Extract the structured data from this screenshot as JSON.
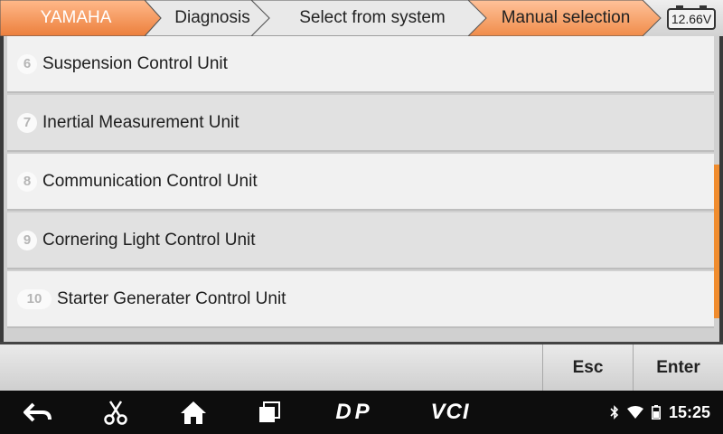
{
  "header": {
    "breadcrumbs": [
      {
        "label": "YAMAHA"
      },
      {
        "label": "Diagnosis"
      },
      {
        "label": "Select from system"
      },
      {
        "label": "Manual selection"
      }
    ],
    "battery_voltage": "12.66V"
  },
  "list": {
    "items": [
      {
        "number": "6",
        "label": "Suspension Control Unit"
      },
      {
        "number": "7",
        "label": "Inertial Measurement Unit"
      },
      {
        "number": "8",
        "label": "Communication Control Unit"
      },
      {
        "number": "9",
        "label": "Cornering Light Control Unit"
      },
      {
        "number": "10",
        "label": "Starter Generater Control Unit"
      }
    ]
  },
  "actions": {
    "esc_label": "Esc",
    "enter_label": "Enter"
  },
  "navbar": {
    "icons": [
      "back-icon",
      "scissors-icon",
      "home-icon",
      "recent-apps-icon",
      "dp-logo-icon",
      "vci-logo-icon"
    ],
    "dp_text": "DP",
    "vci_text": "VCI"
  },
  "status": {
    "time": "15:25",
    "icons": [
      "bluetooth-icon",
      "wifi-icon",
      "battery-icon"
    ]
  },
  "colors": {
    "accent_orange": "#f08c2e",
    "crumb_orange": "#f5a36a",
    "crumb_grey": "#e6e6e6"
  }
}
